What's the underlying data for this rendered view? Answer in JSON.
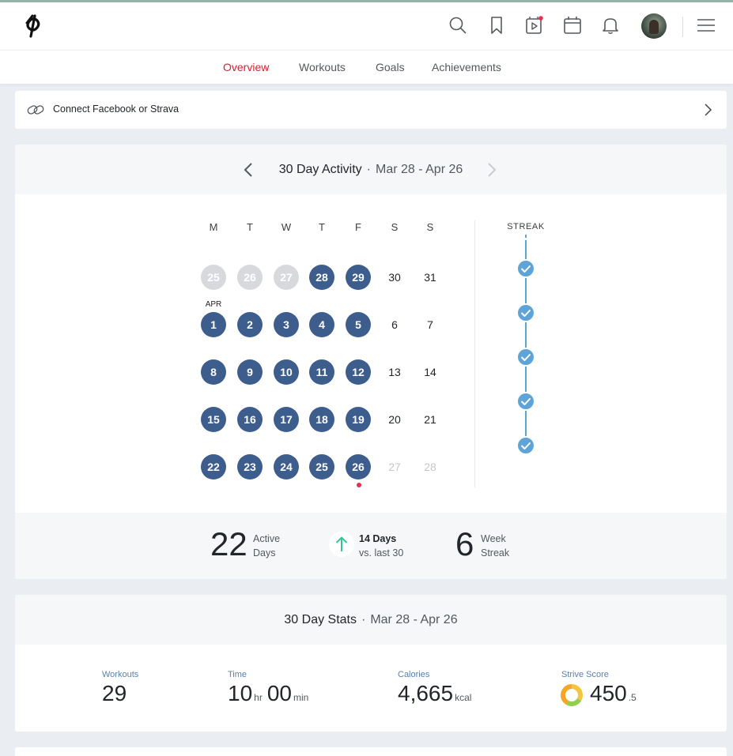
{
  "header": {
    "logo_icon": "peloton-logo-icon",
    "icons": [
      "search-icon",
      "bookmark-icon",
      "video-icon",
      "calendar-icon",
      "bell-icon",
      "menu-icon"
    ],
    "accent_color": "#df1c2f"
  },
  "nav": {
    "tabs": [
      {
        "label": "Overview",
        "active": true
      },
      {
        "label": "Workouts",
        "active": false
      },
      {
        "label": "Goals",
        "active": false
      },
      {
        "label": "Achievements",
        "active": false
      }
    ]
  },
  "connect": {
    "label": "Connect Facebook or Strava"
  },
  "activity": {
    "title": "30 Day Activity",
    "separator": "·",
    "range": "Mar 28 - Apr 26",
    "weekdays": [
      "M",
      "T",
      "W",
      "T",
      "F",
      "S",
      "S"
    ],
    "month_label": "APR",
    "weeks": [
      [
        {
          "d": "25",
          "s": "past"
        },
        {
          "d": "26",
          "s": "past"
        },
        {
          "d": "27",
          "s": "past"
        },
        {
          "d": "28",
          "s": "active"
        },
        {
          "d": "29",
          "s": "active"
        },
        {
          "d": "30",
          "s": "plain"
        },
        {
          "d": "31",
          "s": "plain"
        }
      ],
      [
        {
          "d": "1",
          "s": "active"
        },
        {
          "d": "2",
          "s": "active"
        },
        {
          "d": "3",
          "s": "active"
        },
        {
          "d": "4",
          "s": "active"
        },
        {
          "d": "5",
          "s": "active"
        },
        {
          "d": "6",
          "s": "plain"
        },
        {
          "d": "7",
          "s": "plain"
        }
      ],
      [
        {
          "d": "8",
          "s": "active"
        },
        {
          "d": "9",
          "s": "active"
        },
        {
          "d": "10",
          "s": "active"
        },
        {
          "d": "11",
          "s": "active"
        },
        {
          "d": "12",
          "s": "active"
        },
        {
          "d": "13",
          "s": "plain"
        },
        {
          "d": "14",
          "s": "plain"
        }
      ],
      [
        {
          "d": "15",
          "s": "active"
        },
        {
          "d": "16",
          "s": "active"
        },
        {
          "d": "17",
          "s": "active"
        },
        {
          "d": "18",
          "s": "active"
        },
        {
          "d": "19",
          "s": "active"
        },
        {
          "d": "20",
          "s": "plain"
        },
        {
          "d": "21",
          "s": "plain"
        }
      ],
      [
        {
          "d": "22",
          "s": "active"
        },
        {
          "d": "23",
          "s": "active"
        },
        {
          "d": "24",
          "s": "active"
        },
        {
          "d": "25",
          "s": "active"
        },
        {
          "d": "26",
          "s": "active"
        },
        {
          "d": "27",
          "s": "future"
        },
        {
          "d": "28",
          "s": "future"
        }
      ]
    ],
    "streak_label": "STREAK",
    "streak_weeks": 5,
    "active_color": "#3d5d8d",
    "streak_color": "#5fa4d6"
  },
  "summary": {
    "active_days_value": "22",
    "active_days_label_1": "Active",
    "active_days_label_2": "Days",
    "vs_value": "14 Days",
    "vs_label": "vs. last 30",
    "streak_value": "6",
    "streak_label_1": "Week",
    "streak_label_2": "Streak"
  },
  "stats": {
    "title": "30 Day Stats",
    "separator": "·",
    "range": "Mar 28 - Apr 26",
    "workouts_label": "Workouts",
    "workouts_value": "29",
    "time_label": "Time",
    "time_hours": "10",
    "time_hours_unit": "hr",
    "time_minutes": "00",
    "time_minutes_unit": "min",
    "calories_label": "Calories",
    "calories_value": "4,665",
    "calories_unit": "kcal",
    "strive_label": "Strive Score",
    "strive_value": "450",
    "strive_decimal": ".5"
  }
}
